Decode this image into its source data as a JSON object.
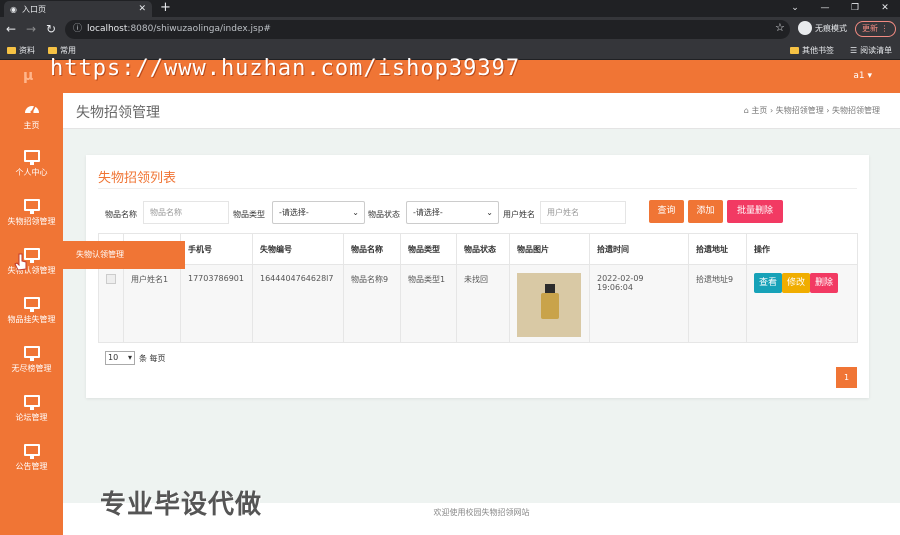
{
  "browser": {
    "tab_title": "入口页",
    "url_host": "localhost",
    "url_rest": ":8080/shiwuzaolinga/index.jsp#",
    "incognito_label": "无痕模式",
    "update_label": "更新",
    "bookmarks": [
      "资料",
      "常用"
    ],
    "other_bookmarks": "其他书签",
    "reading_list": "阅读清单"
  },
  "watermark_url": "https://www.huzhan.com/ishop39397",
  "header": {
    "logo": "μ",
    "user": "a1 ▾"
  },
  "sidebar": {
    "items": [
      {
        "label": "主页",
        "icon": "dashboard-icon"
      },
      {
        "label": "个人中心",
        "icon": "monitor-icon"
      },
      {
        "label": "失物招领管理",
        "icon": "monitor-icon"
      },
      {
        "label": "失物认领管理",
        "icon": "monitor-icon"
      },
      {
        "label": "物品挂失管理",
        "icon": "monitor-icon"
      },
      {
        "label": "无尽榜管理",
        "icon": "monitor-icon"
      },
      {
        "label": "论坛管理",
        "icon": "monitor-icon"
      },
      {
        "label": "公告管理",
        "icon": "monitor-icon"
      }
    ],
    "flyout": "失物认领管理"
  },
  "page": {
    "title": "失物招领管理",
    "crumbs": {
      "home": "主页",
      "c1": "失物招领管理",
      "c2": "失物招领管理"
    }
  },
  "list": {
    "title": "失物招领列表",
    "filters": {
      "name_label": "物品名称",
      "name_placeholder": "物品名称",
      "type_label": "物品类型",
      "type_value": "-请选择-",
      "status_label": "物品状态",
      "status_value": "-请选择-",
      "user_label": "用户姓名",
      "user_placeholder": "用户姓名"
    },
    "buttons": {
      "query": "查询",
      "add": "添加",
      "batch_delete": "批量删除"
    },
    "columns": [
      "",
      "用户姓名",
      "手机号",
      "失物编号",
      "物品名称",
      "物品类型",
      "物品状态",
      "物品图片",
      "拾遗时间",
      "拾遗地址",
      "操作"
    ],
    "rows": [
      {
        "user": "用户姓名1",
        "phone": "17703786901",
        "code": "1644404764628l7",
        "item": "物品名称9",
        "type": "物品类型1",
        "status": "未找回",
        "time": "2022-02-09 19:06:04",
        "address": "拾遗地址9"
      }
    ],
    "row_actions": {
      "view": "查看",
      "edit": "修改",
      "delete": "删除"
    },
    "pagination": {
      "page_size": "10",
      "per_page_label": "条 每页",
      "current_page": "1"
    }
  },
  "footer": "欢迎使用校园失物招领网站",
  "promo": "专业毕设代做",
  "colors": {
    "brand": "#f07535",
    "view": "#17a2b8",
    "edit": "#f0ad00",
    "delete": "#f23a63"
  }
}
